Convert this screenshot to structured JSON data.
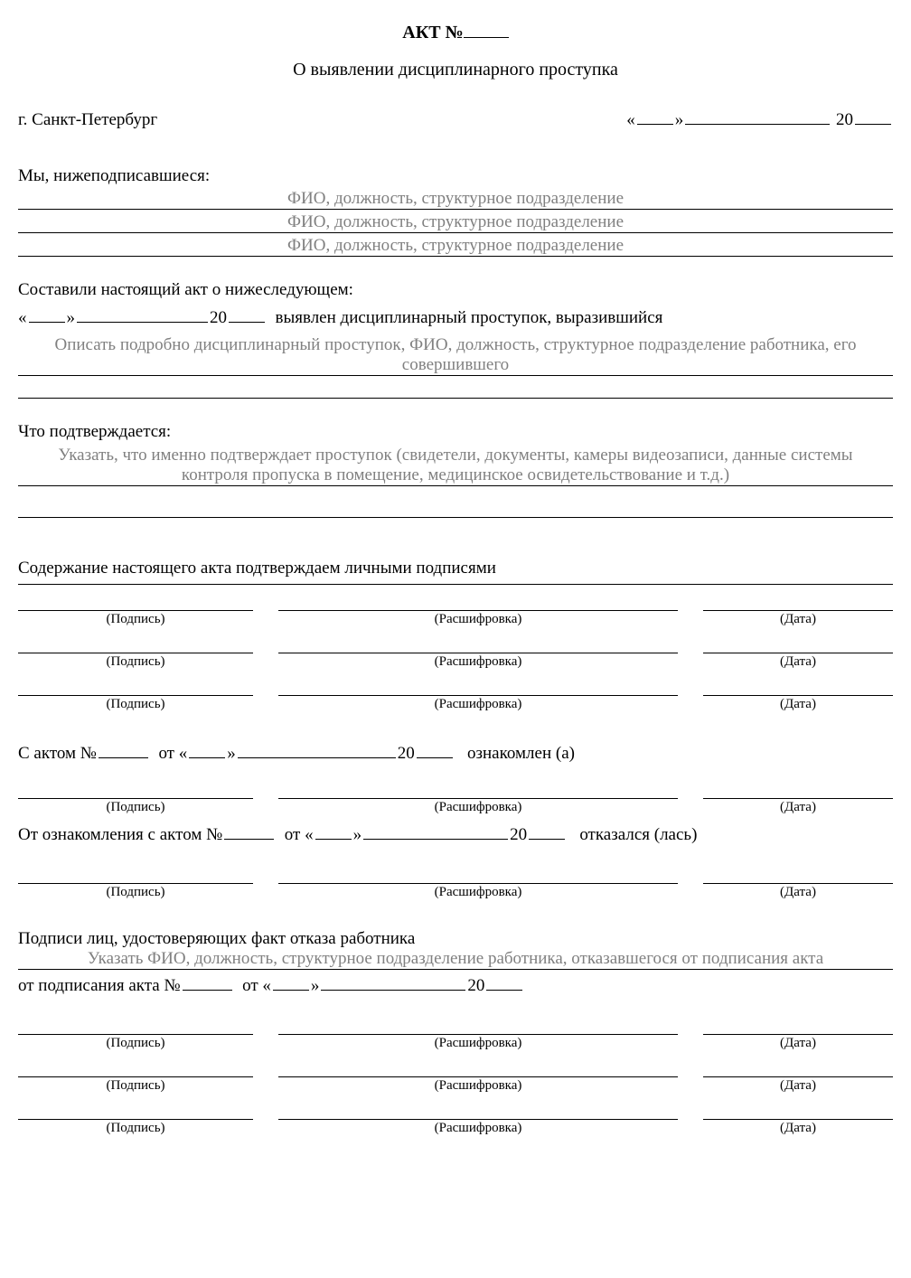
{
  "title_prefix": "АКТ №",
  "subtitle": "О выявлении дисциплинарного проступка",
  "city": "г. Санкт-Петербург",
  "date_open": "«",
  "date_close": "»",
  "century": "20",
  "we_undersigned": "Мы, нижеподписавшиеся:",
  "person_hint": "ФИО, должность, структурное подразделение",
  "compiled_about": "Составили настоящий акт о нижеследующем:",
  "violation_detected": "выявлен дисциплинарный проступок, выразившийся",
  "violation_hint": "Описать подробно дисциплинарный проступок, ФИО, должность, структурное подразделение работника, его совершившего",
  "confirmed_by": "Что подтверждается:",
  "confirmed_hint": "Указать, что именно подтверждает проступок (свидетели, документы, камеры видеозаписи, данные системы контроля пропуска в помещение, медицинское освидетельствование и т.д.)",
  "content_confirm": "Содержание настоящего акта подтверждаем личными подписями",
  "sig_label": "(Подпись)",
  "trans_label": "(Расшифровка)",
  "date_label": "(Дата)",
  "with_act_prefix": "С актом №",
  "from": "от",
  "acquainted": "ознакомлен (а)",
  "refused_prefix": "От ознакомления с актом №",
  "refused_suffix": "отказался (лась)",
  "refusal_sig_heading": "Подписи лиц, удостоверяющих факт отказа работника",
  "refusal_hint": "Указать ФИО, должность, структурное подразделение работника, отказавшегося от подписания акта",
  "from_signing_prefix": "от подписания акта №"
}
